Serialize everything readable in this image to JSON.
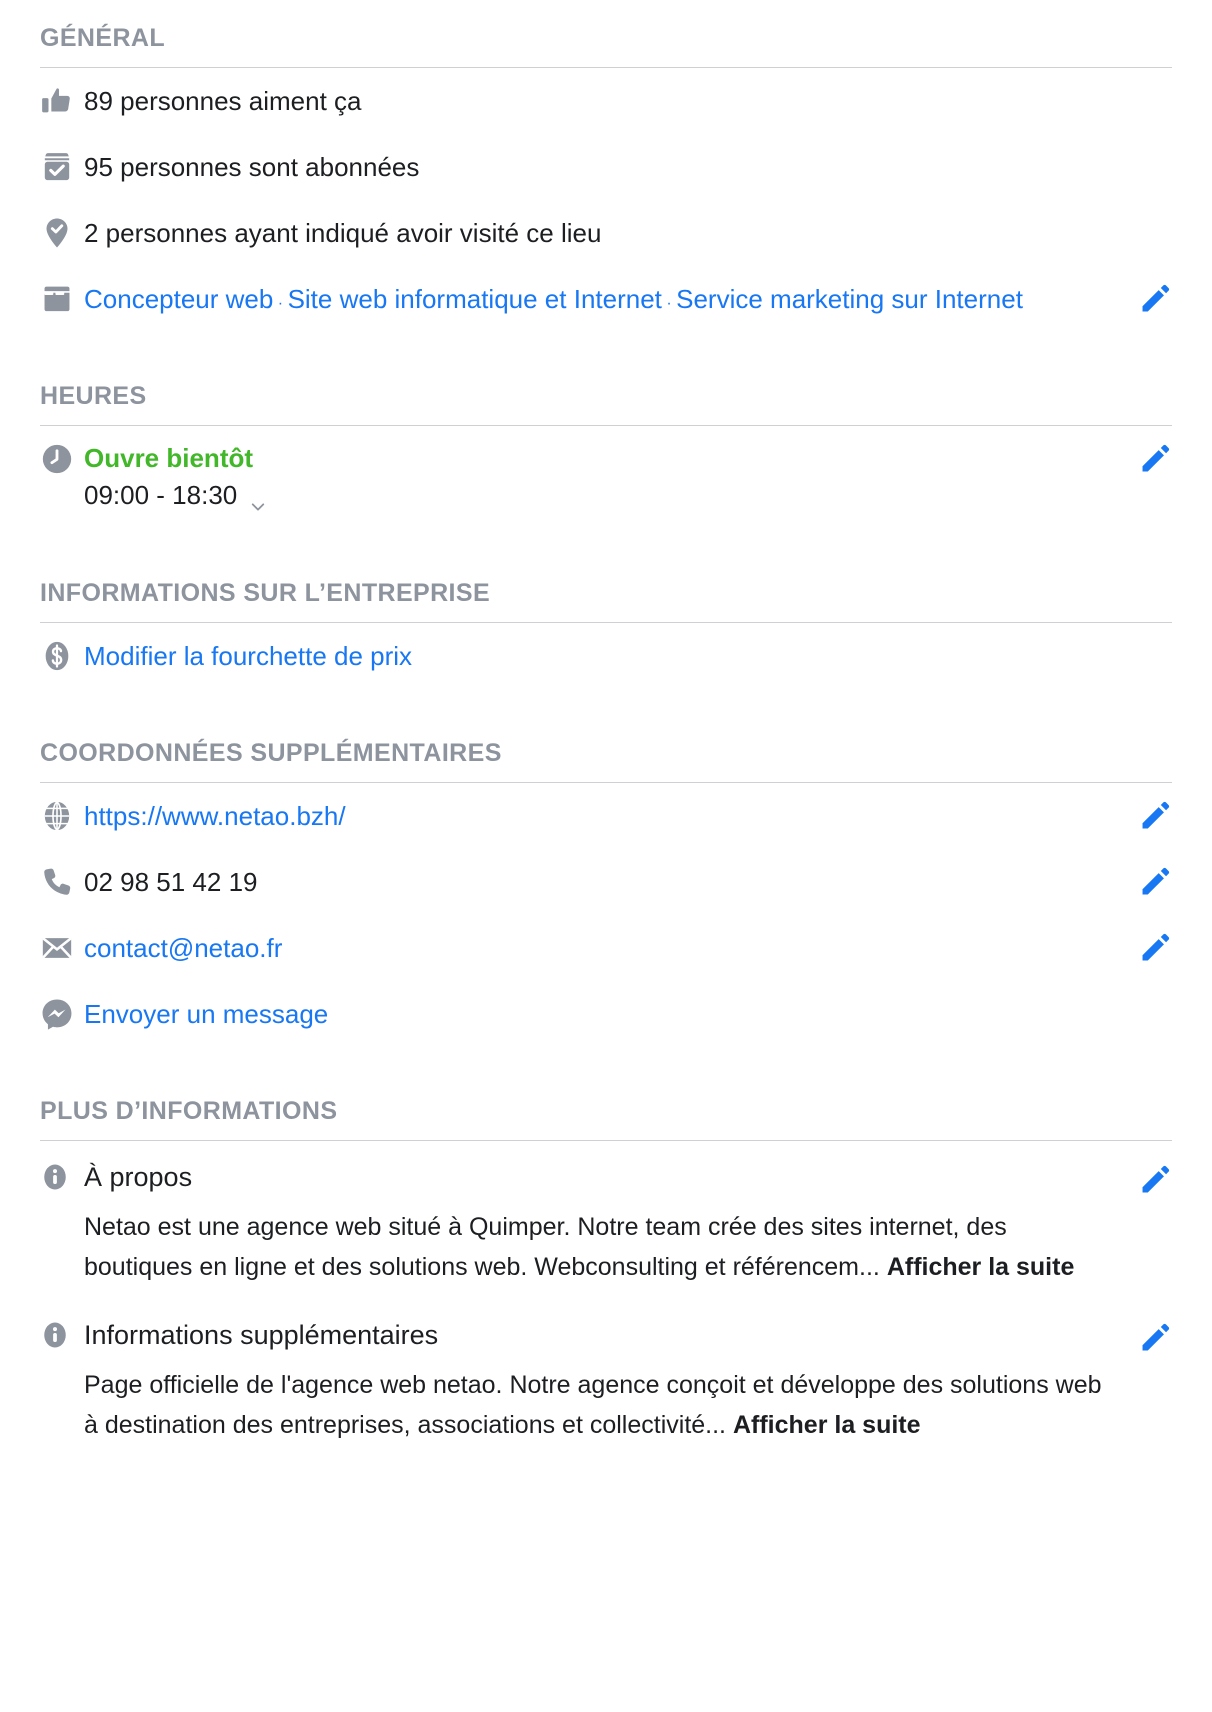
{
  "accent": {
    "link_blue": "#1877f2",
    "open_green": "#42b72a",
    "icon_gray": "#8d949e",
    "heading_gray": "#8d949e",
    "divider": "#ced0d4"
  },
  "sections": {
    "general": {
      "title": "GÉNÉRAL",
      "likes": "89 personnes aiment ça",
      "followers": "95 personnes sont abonnées",
      "checkins": "2 personnes ayant indiqué avoir visité ce lieu",
      "categories": [
        "Concepteur web",
        "Site web informatique et Internet",
        "Service marketing sur Internet"
      ],
      "category_separator": " · "
    },
    "hours": {
      "title": "HEURES",
      "status": "Ouvre bientôt",
      "range": "09:00 - 18:30"
    },
    "business_info": {
      "title": "INFORMATIONS SUR L’ENTREPRISE",
      "price_range_link": "Modifier la fourchette de prix"
    },
    "contact": {
      "title": "COORDONNÉES SUPPLÉMENTAIRES",
      "website": "https://www.netao.bzh/",
      "phone": "02 98 51 42 19",
      "email": "contact@netao.fr",
      "messenger": "Envoyer un message"
    },
    "more_info": {
      "title": "PLUS D’INFORMATIONS",
      "about": {
        "heading": "À propos",
        "body": "Netao est une agence web situé à Quimper. Notre team crée des sites internet, des boutiques en ligne et des solutions web. Webconsulting et référencem...",
        "more_label": "Afficher la suite"
      },
      "additional": {
        "heading": "Informations supplémentaires",
        "body": "Page officielle de l'agence web netao. Notre agence conçoit et développe des solutions web à destination des entreprises, associations et collectivité...",
        "more_label": "Afficher la suite"
      }
    }
  }
}
